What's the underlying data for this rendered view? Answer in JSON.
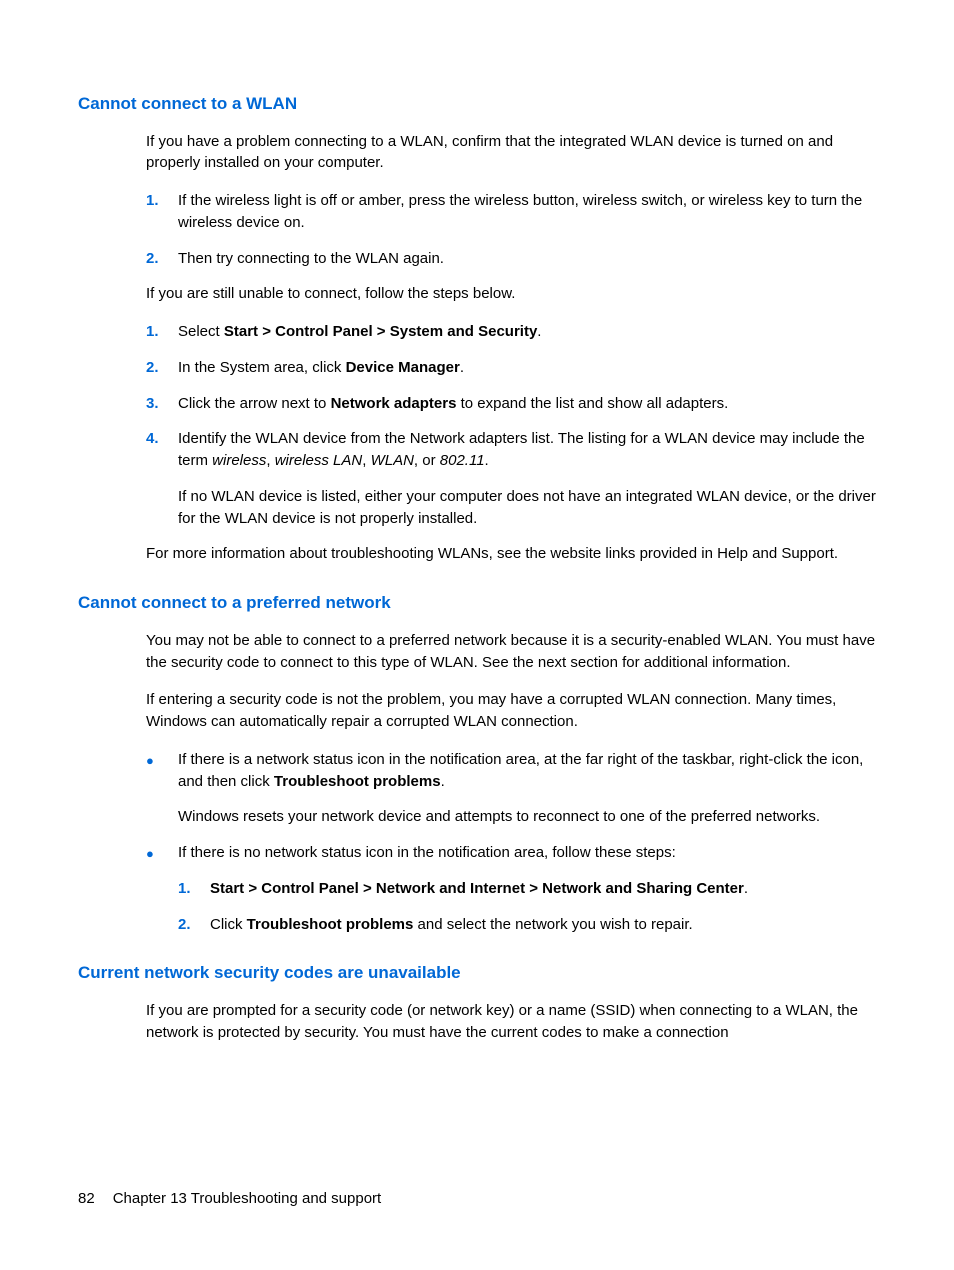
{
  "section1": {
    "heading": "Cannot connect to a WLAN",
    "intro": "If you have a problem connecting to a WLAN, confirm that the integrated WLAN device is turned on and properly installed on your computer.",
    "list1": {
      "item1": "If the wireless light is off or amber, press the wireless button, wireless switch, or wireless key to turn the wireless device on.",
      "item2": "Then try connecting to the WLAN again."
    },
    "middle": "If you are still unable to connect, follow the steps below.",
    "list2": {
      "item1_pre": "Select ",
      "item1_bold": "Start > Control Panel > System and Security",
      "item1_post": ".",
      "item2_pre": "In the System area, click ",
      "item2_bold": "Device Manager",
      "item2_post": ".",
      "item3_pre": "Click the arrow next to ",
      "item3_bold": "Network adapters",
      "item3_post": " to expand the list and show all adapters.",
      "item4_p1_pre": "Identify the WLAN device from the Network adapters list. The listing for a WLAN device may include the term ",
      "item4_em1": "wireless",
      "item4_sep1": ", ",
      "item4_em2": "wireless LAN",
      "item4_sep2": ", ",
      "item4_em3": "WLAN",
      "item4_sep3": ", or ",
      "item4_em4": "802.11",
      "item4_post": ".",
      "item4_p2": "If no WLAN device is listed, either your computer does not have an integrated WLAN device, or the driver for the WLAN device is not properly installed."
    },
    "outro": "For more information about troubleshooting WLANs, see the website links provided in Help and Support."
  },
  "section2": {
    "heading": "Cannot connect to a preferred network",
    "p1": "You may not be able to connect to a preferred network because it is a security-enabled WLAN. You must have the security code to connect to this type of WLAN. See the next section for additional information.",
    "p2": "If entering a security code is not the problem, you may have a corrupted WLAN connection. Many times, Windows can automatically repair a corrupted WLAN connection.",
    "bullet1_p1_pre": "If there is a network status icon in the notification area, at the far right of the taskbar, right-click the icon, and then click ",
    "bullet1_p1_bold": "Troubleshoot problems",
    "bullet1_p1_post": ".",
    "bullet1_p2": "Windows resets your network device and attempts to reconnect to one of the preferred networks.",
    "bullet2_p1": "If there is no network status icon in the notification area, follow these steps:",
    "bullet2_n1_bold": "Start > Control Panel > Network and Internet > Network and Sharing Center",
    "bullet2_n1_post": ".",
    "bullet2_n2_pre": "Click ",
    "bullet2_n2_bold": "Troubleshoot problems",
    "bullet2_n2_post": " and select the network you wish to repair."
  },
  "section3": {
    "heading": "Current network security codes are unavailable",
    "p1": "If you are prompted for a security code (or network key) or a name (SSID) when connecting to a WLAN, the network is protected by security. You must have the current codes to make a connection"
  },
  "footer": {
    "page": "82",
    "chapter": "Chapter 13   Troubleshooting and support"
  },
  "numbers": {
    "n1": "1.",
    "n2": "2.",
    "n3": "3.",
    "n4": "4."
  },
  "bullet": "●"
}
